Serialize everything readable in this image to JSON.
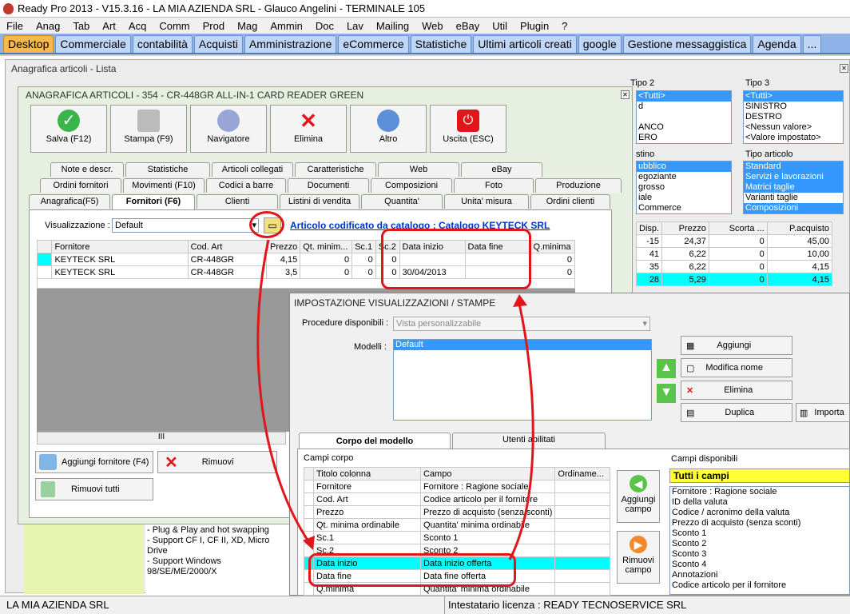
{
  "titlebar": {
    "title": "Ready Pro 2013 - V15.3.16 - LA MIA AZIENDA SRL - Glauco Angelini - TERMINALE 105"
  },
  "menu": [
    "File",
    "Anag",
    "Tab",
    "Art",
    "Acq",
    "Comm",
    "Prod",
    "Mag",
    "Ammin",
    "Doc",
    "Lav",
    "Mailing",
    "Web",
    "eBay",
    "Util",
    "Plugin",
    "?"
  ],
  "tabs": [
    "Desktop",
    "Commerciale",
    "contabilità",
    "Acquisti",
    "Amministrazione",
    "eCommerce",
    "Statistiche",
    "Ultimi articoli creati",
    "google",
    "Gestione messaggistica",
    "Agenda",
    "..."
  ],
  "lista": {
    "title": "Anagrafica articoli  - Lista",
    "tipo2": {
      "label": "Tipo 2",
      "items": [
        "<Tutti>",
        "d",
        "",
        "ANCO",
        "ERO"
      ]
    },
    "tipo3": {
      "label": "Tipo 3",
      "items": [
        "<Tutti>",
        "SINISTRO",
        "DESTRO",
        "<Nessun valore>",
        "<Valore impostato>"
      ]
    },
    "listino": {
      "label": "stino",
      "items": [
        "ubblico",
        "egoziante",
        "grosso",
        "iale",
        "Commerce"
      ]
    },
    "tipoart": {
      "label": "Tipo articolo",
      "items": [
        "Standard",
        "Servizi e lavorazioni",
        "Matrici taglie",
        "Varianti taglie",
        "Composizioni"
      ]
    },
    "grid": {
      "headers": [
        "Disp.",
        "Prezzo",
        "Scorta ...",
        "P.acquisto"
      ],
      "rows": [
        [
          "-15",
          "24,37",
          "0",
          "45,00"
        ],
        [
          "41",
          "6,22",
          "0",
          "10,00"
        ],
        [
          "35",
          "6,22",
          "0",
          "4,15"
        ],
        [
          "28",
          "5,29",
          "0",
          "4,15"
        ]
      ]
    },
    "desc": [
      "- Plug & Play and hot swapping",
      "- Support CF I, CF II, XD, Micro Drive",
      "- Support Windows 98/SE/ME/2000/X"
    ]
  },
  "dialog": {
    "title": "ANAGRAFICA ARTICOLI - 354 - CR-448GR ALL-IN-1 CARD READER GREEN",
    "buttons": [
      "Salva (F12)",
      "Stampa (F9)",
      "Navigatore",
      "Elimina",
      "Altro",
      "Uscita (ESC)"
    ],
    "tabs_row1": [
      "Note e descr.",
      "Statistiche",
      "Articoli collegati",
      "Caratteristiche",
      "Web",
      "eBay"
    ],
    "tabs_row2": [
      "Ordini fornitori",
      "Movimenti (F10)",
      "Codici a barre",
      "Documenti",
      "Composizioni",
      "Foto",
      "Produzione"
    ],
    "tabs_row3": [
      "Anagrafica(F5)",
      "Fornitori (F6)",
      "Clienti",
      "Listini di vendita",
      "Quantita'",
      "Unita' misura",
      "Ordini clienti"
    ],
    "vis_label": "Visualizzazione :",
    "vis_value": "Default",
    "catalog_link": "Articolo codificato da catalogo : Catalogo KEYTECK SRL",
    "grid_headers": [
      "Fornitore",
      "Cod. Art",
      "Prezzo",
      "Qt. minim...",
      "Sc.1",
      "Sc.2",
      "Data inizio",
      "Data fine",
      "Q.minima"
    ],
    "grid_rows": [
      [
        "KEYTECK SRL",
        "CR-448GR",
        "4,15",
        "0",
        "0",
        "0",
        "",
        "",
        "0"
      ],
      [
        "KEYTECK SRL",
        "CR-448GR",
        "3,5",
        "0",
        "0",
        "0",
        "30/04/2013",
        "",
        "0"
      ]
    ],
    "btn_add": "Aggiungi fornitore (F4)",
    "btn_remove": "Rimuovi",
    "btn_remove_all": "Rimuovi tutti",
    "scroll_mark": "III"
  },
  "imp": {
    "title": "IMPOSTAZIONE VISUALIZZAZIONI / STAMPE",
    "proc_label": "Procedure disponibili :",
    "proc_placeholder": "Vista personalizzabile",
    "modelli_label": "Modelli :",
    "modelli_items": [
      "Default"
    ],
    "side_buttons": [
      "Aggiungi",
      "Modifica nome",
      "Elimina",
      "Duplica"
    ],
    "importa": "Importa",
    "tab_corpo": "Corpo del modello",
    "tab_utenti": "Utenti abilitati",
    "campi_corpo": "Campi corpo",
    "col_headers": [
      "Titolo colonna",
      "Campo",
      "Ordiname..."
    ],
    "rows": [
      [
        "Fornitore",
        "Fornitore : Ragione sociale"
      ],
      [
        "Cod. Art",
        "Codice articolo per il fornitore"
      ],
      [
        "Prezzo",
        "Prezzo di acquisto (senza sconti)"
      ],
      [
        "Qt. minima ordinabile",
        "Quantita' minima ordinabile"
      ],
      [
        "Sc.1",
        "Sconto 1"
      ],
      [
        "Sc.2",
        "Sconto 2"
      ],
      [
        "Data inizio",
        "Data inizio offerta"
      ],
      [
        "Data fine",
        "Data fine offerta"
      ],
      [
        "Q.minima",
        "Quantita' minima ordinabile"
      ]
    ],
    "aggiungi_campo": "Aggiungi campo",
    "rimuovi_campo": "Rimuovi campo",
    "campi_disp": "Campi disponibili",
    "tutti": "Tutti i campi",
    "disp_items": [
      "Fornitore : Ragione sociale",
      "ID della valuta",
      "Codice / acronimo della valuta",
      "Prezzo di acquisto (senza sconti)",
      "Sconto 1",
      "Sconto 2",
      "Sconto 3",
      "Sconto 4",
      "Annotazioni",
      "Codice articolo per il fornitore"
    ]
  },
  "status": {
    "left": "LA MIA AZIENDA SRL",
    "right": "Intestatario licenza : READY TECNOSERVICE SRL"
  },
  "colors": {
    "accent": "#e0161b",
    "selection": "#3399ff",
    "cyan": "#00ffff",
    "tab_active": "#f7b94b"
  }
}
